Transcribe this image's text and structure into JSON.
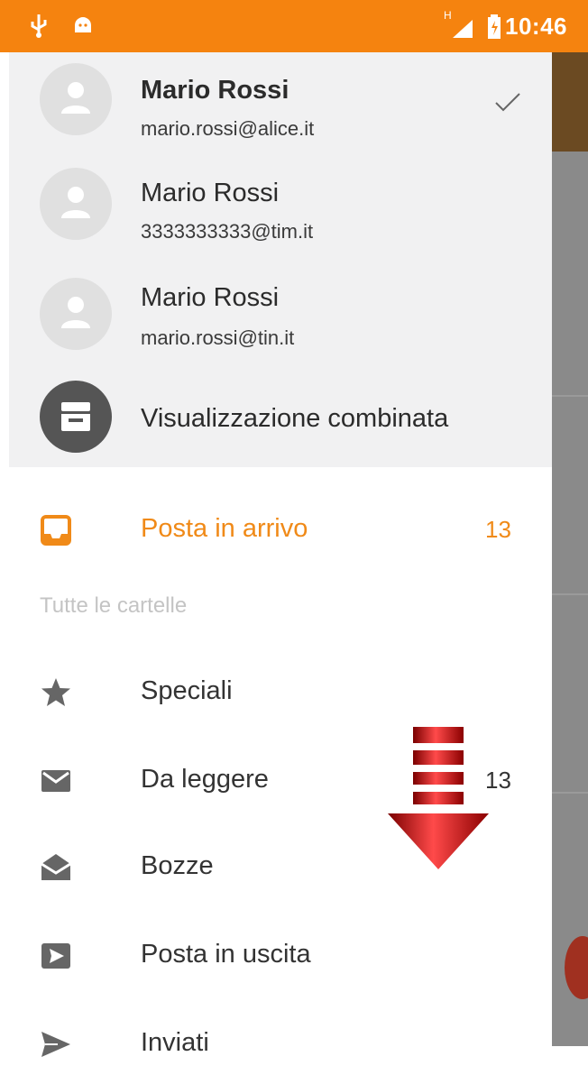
{
  "status_bar": {
    "network": "H",
    "time": "10:46",
    "color": "#f5830f"
  },
  "accounts": [
    {
      "name": "Mario Rossi",
      "email": "mario.rossi@alice.it",
      "selected": true,
      "icon": "person-icon"
    },
    {
      "name": "Mario Rossi",
      "email": "3333333333@tim.it",
      "selected": false,
      "icon": "person-icon"
    },
    {
      "name": "Mario Rossi",
      "email": "mario.rossi@tin.it",
      "selected": false,
      "icon": "person-icon"
    }
  ],
  "combined": {
    "label": "Visualizzazione combinata",
    "icon": "inbox-tray-icon"
  },
  "inbox": {
    "label": "Posta in arrivo",
    "count": "13",
    "icon": "inbox-icon",
    "accent": "#f08a18"
  },
  "folders_header": "Tutte le cartelle",
  "folders": [
    {
      "label": "Speciali",
      "count": "",
      "icon": "star-icon"
    },
    {
      "label": "Da leggere",
      "count": "13",
      "icon": "mail-icon"
    },
    {
      "label": "Bozze",
      "count": "",
      "icon": "open-envelope-icon"
    },
    {
      "label": "Posta in uscita",
      "count": "",
      "icon": "outbox-icon"
    },
    {
      "label": "Inviati",
      "count": "",
      "icon": "send-icon"
    }
  ],
  "overlay": {
    "icon": "scroll-down-arrow-icon"
  }
}
